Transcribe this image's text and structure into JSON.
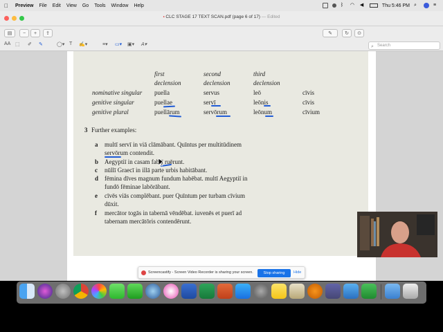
{
  "menubar": {
    "app": "Preview",
    "items": [
      "File",
      "Edit",
      "View",
      "Go",
      "Tools",
      "Window",
      "Help"
    ],
    "clock": "Thu 5:46 PM"
  },
  "window": {
    "title": "CLC STAGE 17 TEXT SCAN.pdf (page 6 of 17)",
    "edited": "— Edited",
    "search_placeholder": "Search"
  },
  "document": {
    "table_headers": [
      {
        "line1": "first",
        "line2": "declension"
      },
      {
        "line1": "second",
        "line2": "declension"
      },
      {
        "line1": "third",
        "line2": "declension"
      }
    ],
    "table_rows": [
      {
        "label": "nominative singular",
        "cells": [
          "puella",
          "servus",
          "leō",
          "cīvis"
        ]
      },
      {
        "label": "genitive singular",
        "cells": [
          "puellae",
          "servī",
          "leōnis",
          "cīvis"
        ]
      },
      {
        "label": "genitive plural",
        "cells": [
          "puellārum",
          "servōrum",
          "leōnum",
          "cīvium"
        ]
      }
    ],
    "section_number": "3",
    "section_title": "Further examples:",
    "examples": [
      {
        "letter": "a",
        "lines": [
          "multī servī in viā clāmābant. Quīntus per multitūdinem",
          "servōrum contendit."
        ]
      },
      {
        "letter": "b",
        "lines": [
          "Aegyptiī in casam fabrī ruērunt."
        ]
      },
      {
        "letter": "c",
        "lines": [
          "nūllī Graecī in illā parte urbis habitābant."
        ]
      },
      {
        "letter": "d",
        "lines": [
          "fēmina dīves magnum fundum habēbat. multī Aegyptiī in",
          "fundō fēminae labōrābant."
        ]
      },
      {
        "letter": "e",
        "lines": [
          "cīvēs viās complēbant. puer Quīntum per turbam cīvium",
          "dūxit."
        ]
      },
      {
        "letter": "f",
        "lines": [
          "mercātor togās in tabernā vēndēbat. iuvenēs et puerī ad",
          "tabernam mercātōris contendērunt."
        ]
      }
    ]
  },
  "sharebar": {
    "message": "Screencastify - Screen Video Recorder is sharing your screen.",
    "stop_label": "Stop sharing",
    "hide_label": "Hide"
  },
  "dock": {
    "icons": [
      "finder-icon",
      "siri-icon",
      "launchpad-icon",
      "chrome-icon",
      "photos-icon",
      "messages-icon",
      "facetime-icon",
      "quicktime-icon",
      "itunes-icon",
      "word-icon",
      "excel-icon",
      "powerpoint-icon",
      "appstore-icon",
      "system-preferences-icon",
      "notes-icon",
      "preview-icon",
      "audacity-icon",
      "teams-icon",
      "keynote-icon",
      "numbers-icon",
      "separator",
      "downloads-icon",
      "trash-icon"
    ]
  },
  "colors": {
    "annotation_underline": "#1f5bd6",
    "panel_background": "#e9e9e1",
    "stop_button": "#1a73e8"
  }
}
